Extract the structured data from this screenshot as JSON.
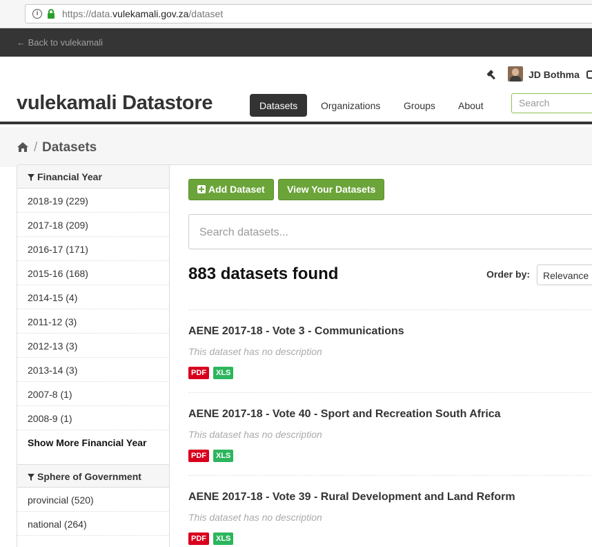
{
  "browser": {
    "url_prefix": "https://data.",
    "url_host": "vulekamali.gov.za",
    "url_path": "/dataset"
  },
  "account_bar": {
    "back_link": "← Back to vulekamali"
  },
  "header": {
    "username": "JD Bothma",
    "site_title": "vulekamali Datastore",
    "nav": [
      "Datasets",
      "Organizations",
      "Groups",
      "About"
    ],
    "active_nav": "Datasets",
    "search_placeholder": "Search"
  },
  "breadcrumb": {
    "separator": "/",
    "current": "Datasets"
  },
  "sidebar": {
    "facets": [
      {
        "heading": "Financial Year",
        "items": [
          "2018-19 (229)",
          "2017-18 (209)",
          "2016-17 (171)",
          "2015-16 (168)",
          "2014-15 (4)",
          "2011-12 (3)",
          "2012-13 (3)",
          "2013-14 (3)",
          "2007-8 (1)",
          "2008-9 (1)"
        ],
        "more": "Show More Financial Year"
      },
      {
        "heading": "Sphere of Government",
        "items": [
          "provincial (520)",
          "national (264)"
        ]
      }
    ]
  },
  "main": {
    "add_dataset": "Add Dataset",
    "view_your_datasets": "View Your Datasets",
    "search_placeholder": "Search datasets...",
    "results_count": "883 datasets found",
    "order_label": "Order by:",
    "order_value": "Relevance",
    "datasets": [
      {
        "title": "AENE 2017-18 - Vote 3 - Communications",
        "description": "This dataset has no description",
        "formats": [
          "PDF",
          "XLS"
        ]
      },
      {
        "title": "AENE 2017-18 - Vote 40 - Sport and Recreation South Africa",
        "description": "This dataset has no description",
        "formats": [
          "PDF",
          "XLS"
        ]
      },
      {
        "title": "AENE 2017-18 - Vote 39 - Rural Development and Land Reform",
        "description": "This dataset has no description",
        "formats": [
          "PDF",
          "XLS"
        ]
      }
    ]
  },
  "colors": {
    "accent_green": "#6ba439",
    "dark_bar": "#353535",
    "pdf_label": "#d9001d",
    "xls_label": "#2db55d"
  }
}
